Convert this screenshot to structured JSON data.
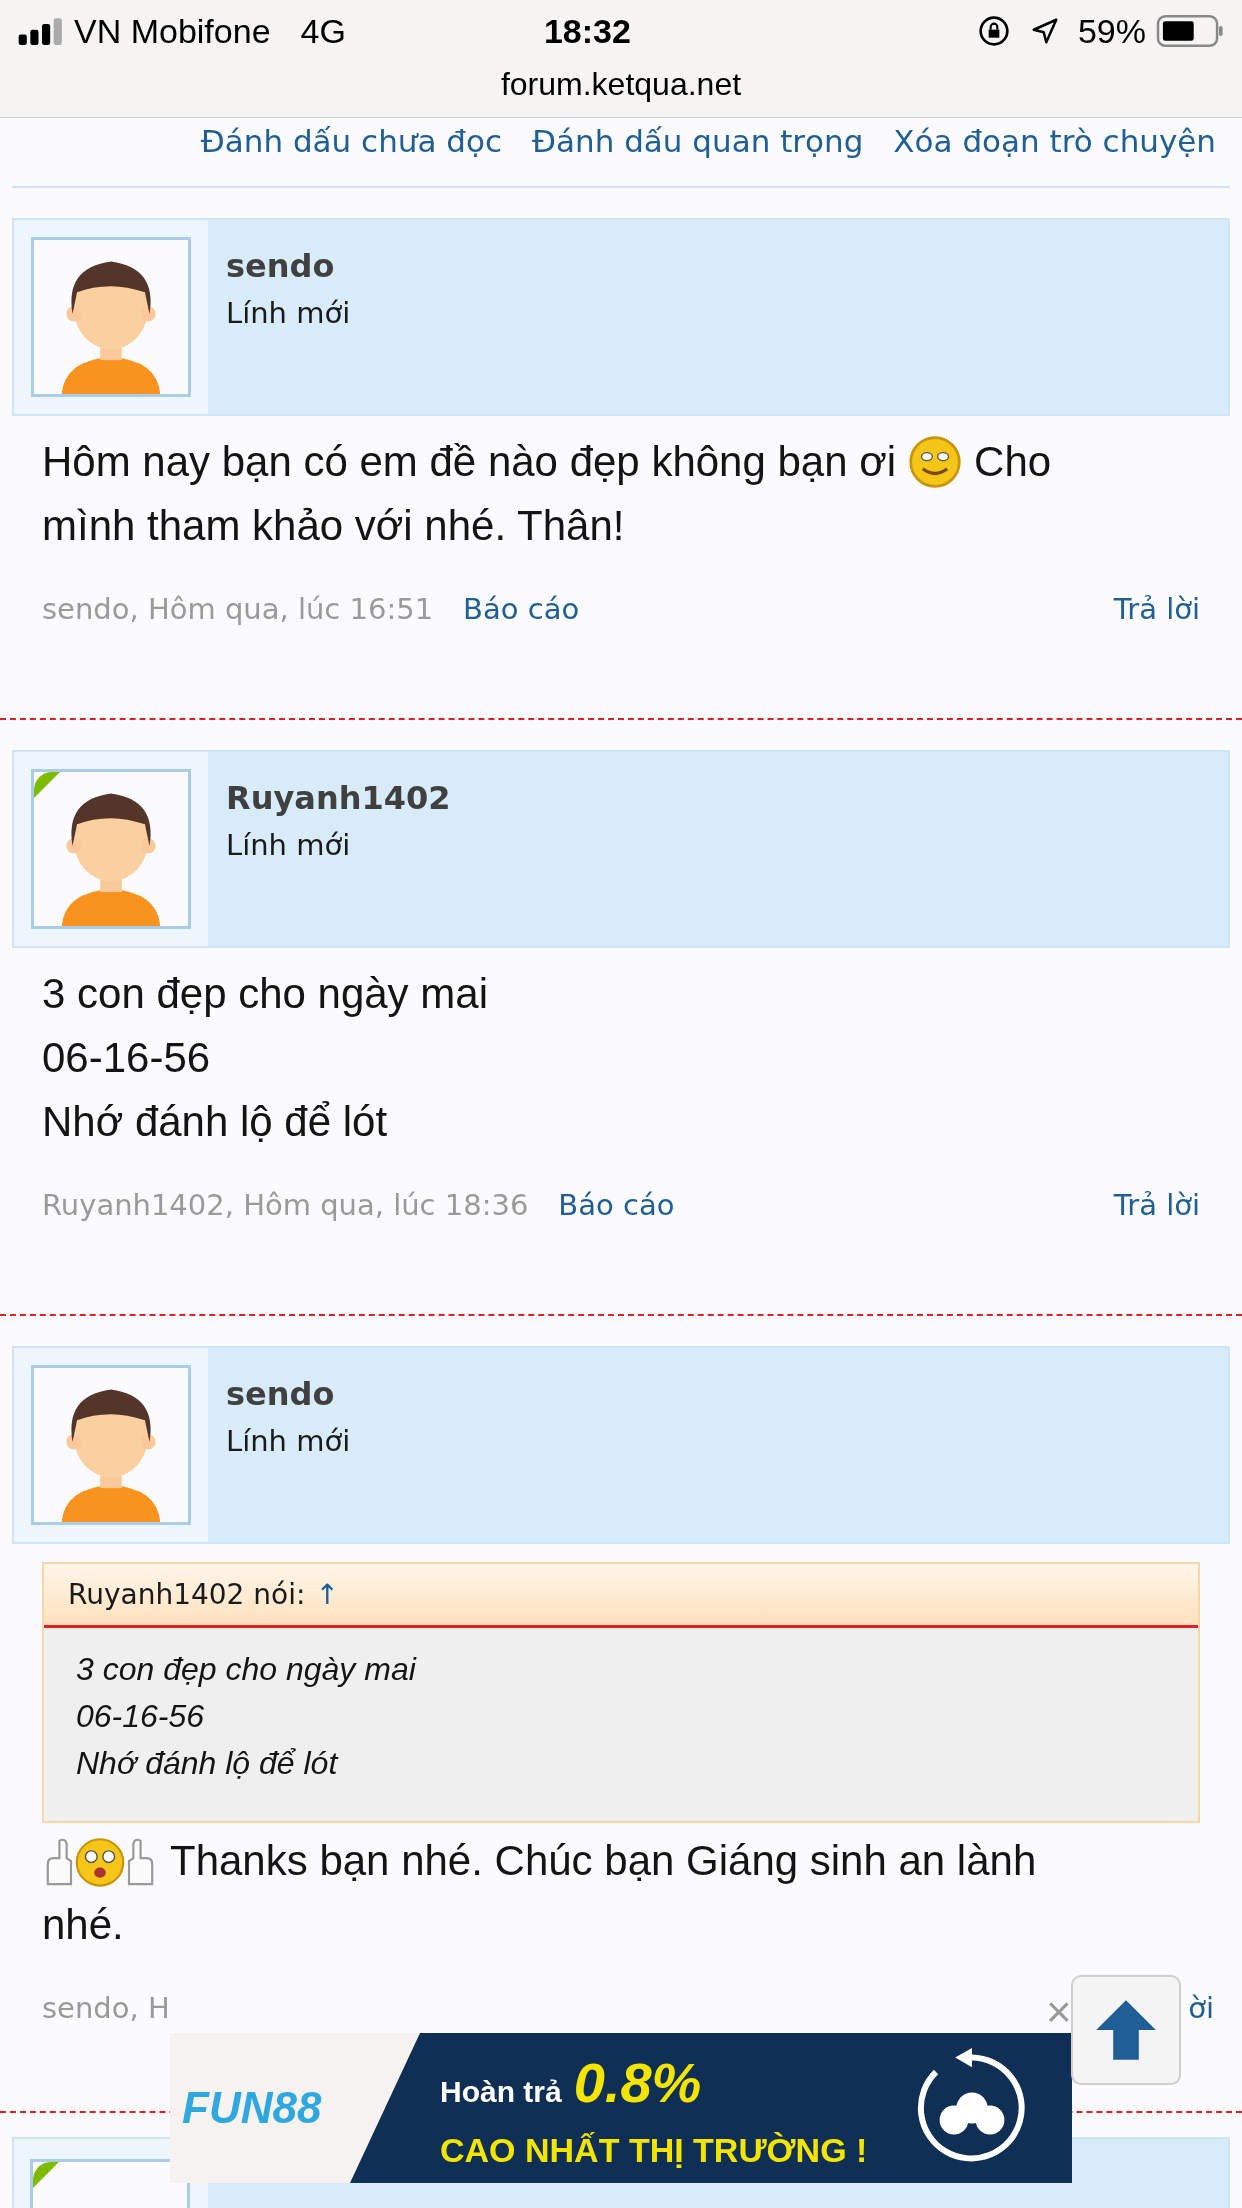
{
  "status_bar": {
    "carrier": "VN Mobifone",
    "network": "4G",
    "time": "18:32",
    "battery": "59%",
    "url": "forum.ketqua.net"
  },
  "top_links": [
    "Đánh dấu chưa đọc",
    "Đánh dấu quan trọng",
    "Xóa đoạn trò chuyện"
  ],
  "posts": [
    {
      "author": "sendo",
      "rank": "Lính mới",
      "online": false,
      "message": [
        [
          {
            "kind": "text",
            "text": "Hôm nay bạn có em đề nào đẹp không bạn ơi"
          },
          {
            "kind": "smiley"
          },
          {
            "kind": "text",
            "text": "Cho"
          }
        ],
        [
          {
            "kind": "text",
            "text": "mình tham khảo với nhé. Thân!"
          }
        ]
      ],
      "meta": "sendo, Hôm qua, lúc 16:51",
      "report": "Báo cáo",
      "reply": "Trả lời"
    },
    {
      "author": "Ruyanh1402",
      "rank": "Lính mới",
      "online": true,
      "message": [
        [
          {
            "kind": "text",
            "text": "3 con đẹp cho ngày mai"
          }
        ],
        [
          {
            "kind": "text",
            "text": "06-16-56"
          }
        ],
        [
          {
            "kind": "text",
            "text": "Nhớ đánh lộ để lót"
          }
        ]
      ],
      "meta": "Ruyanh1402, Hôm qua, lúc 18:36",
      "report": "Báo cáo",
      "reply": "Trả lời"
    },
    {
      "author": "sendo",
      "rank": "Lính mới",
      "online": false,
      "quote": {
        "header": "Ruyanh1402 nói:",
        "arrow": "↑",
        "lines": [
          "3 con đẹp cho ngày mai",
          "06-16-56",
          "Nhớ đánh lộ để lót"
        ]
      },
      "message": [
        [
          {
            "kind": "thumbs"
          },
          {
            "kind": "text",
            "text": "Thanks bạn nhé. Chúc bạn Giáng sinh an lành"
          }
        ],
        [
          {
            "kind": "text",
            "text": "nhé."
          }
        ]
      ],
      "meta": "sendo, H",
      "reply": "ời"
    }
  ],
  "partial_post": {
    "online": true
  },
  "ad": {
    "brand": "FUN88",
    "line1": "Hoàn trả",
    "highlight": "0.8%",
    "line2": "CAO NHẤT THỊ TRƯỜNG !"
  },
  "close": "×"
}
